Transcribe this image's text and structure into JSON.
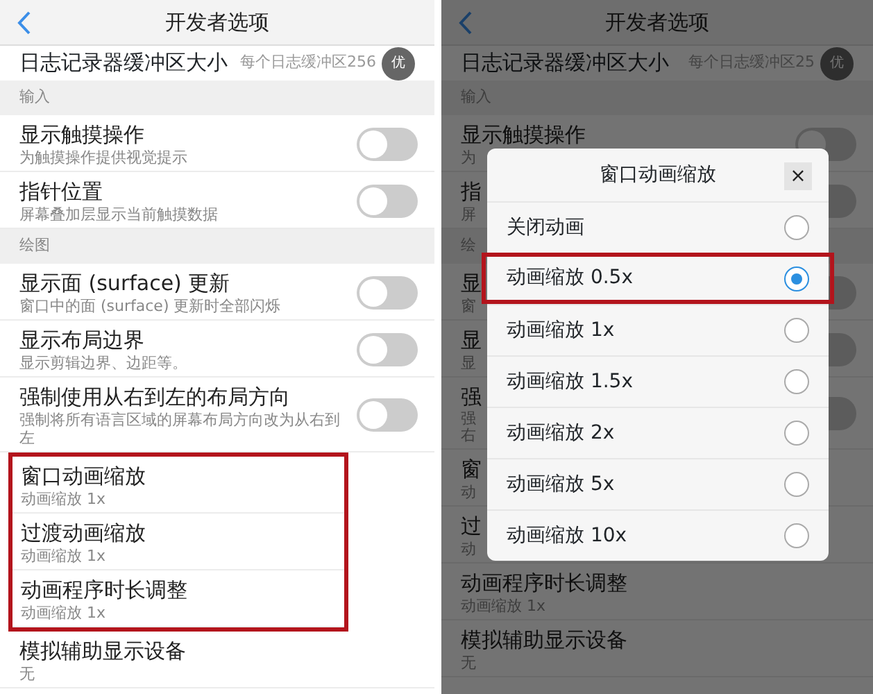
{
  "panels": [
    {
      "header": {
        "title": "开发者选项"
      },
      "badge": "优",
      "dimmed": false,
      "rows": [
        {
          "kind": "value",
          "title": "日志记录器缓冲区大小",
          "value": "每个日志缓冲区256"
        },
        {
          "kind": "section",
          "title": "输入"
        },
        {
          "kind": "toggle",
          "title": "显示触摸操作",
          "subtitle": "为触摸操作提供视觉提示",
          "on": false
        },
        {
          "kind": "toggle",
          "title": "指针位置",
          "subtitle": "屏幕叠加层显示当前触摸数据",
          "on": false
        },
        {
          "kind": "section",
          "title": "绘图"
        },
        {
          "kind": "toggle",
          "title": "显示面 (surface) 更新",
          "subtitle": "窗口中的面 (surface) 更新时全部闪烁",
          "on": false
        },
        {
          "kind": "toggle",
          "title": "显示布局边界",
          "subtitle": "显示剪辑边界、边距等。",
          "on": false
        },
        {
          "kind": "toggle",
          "title": "强制使用从右到左的布局方向",
          "subtitle": "强制将所有语言区域的屏幕布局方向改为从右到左",
          "on": false
        },
        {
          "kind": "detail",
          "title": "窗口动画缩放",
          "subtitle": "动画缩放 1x",
          "highlighted": true
        },
        {
          "kind": "detail",
          "title": "过渡动画缩放",
          "subtitle": "动画缩放 1x",
          "highlighted": true
        },
        {
          "kind": "detail",
          "title": "动画程序时长调整",
          "subtitle": "动画缩放 1x",
          "highlighted": true
        },
        {
          "kind": "detail",
          "title": "模拟辅助显示设备",
          "subtitle": "无",
          "highlighted": false
        }
      ]
    },
    {
      "header": {
        "title": "开发者选项"
      },
      "badge": "优",
      "dimmed": true,
      "rows": [
        {
          "kind": "value",
          "title": "日志记录器缓冲区大小",
          "value": "每个日志缓冲区25"
        },
        {
          "kind": "section",
          "title": "输入"
        },
        {
          "kind": "toggle",
          "title": "显示触摸操作",
          "subtitle": "为",
          "on": false
        },
        {
          "kind": "toggle",
          "title": "指",
          "subtitle": "屏",
          "on": false
        },
        {
          "kind": "section",
          "title": "绘"
        },
        {
          "kind": "toggle",
          "title": "显",
          "subtitle": "窗",
          "on": false
        },
        {
          "kind": "toggle",
          "title": "显",
          "subtitle": "显",
          "on": false
        },
        {
          "kind": "toggle",
          "title": "强",
          "subtitle": "强右",
          "on": false
        },
        {
          "kind": "detail",
          "title": "窗",
          "subtitle": "动",
          "highlighted": false
        },
        {
          "kind": "detail",
          "title": "过",
          "subtitle": "动",
          "highlighted": false
        },
        {
          "kind": "detail",
          "title": "动画程序时长调整",
          "subtitle": "动画缩放 1x",
          "highlighted": false
        },
        {
          "kind": "detail",
          "title": "模拟辅助显示设备",
          "subtitle": "无",
          "highlighted": false
        }
      ],
      "dialog": {
        "title": "窗口动画缩放",
        "close": "×",
        "options": [
          {
            "label": "关闭动画",
            "selected": false,
            "highlighted": false
          },
          {
            "label": "动画缩放 0.5x",
            "selected": true,
            "highlighted": true
          },
          {
            "label": "动画缩放 1x",
            "selected": false,
            "highlighted": false
          },
          {
            "label": "动画缩放 1.5x",
            "selected": false,
            "highlighted": false
          },
          {
            "label": "动画缩放 2x",
            "selected": false,
            "highlighted": false
          },
          {
            "label": "动画缩放 5x",
            "selected": false,
            "highlighted": false
          },
          {
            "label": "动画缩放 10x",
            "selected": false,
            "highlighted": false
          }
        ]
      }
    }
  ]
}
